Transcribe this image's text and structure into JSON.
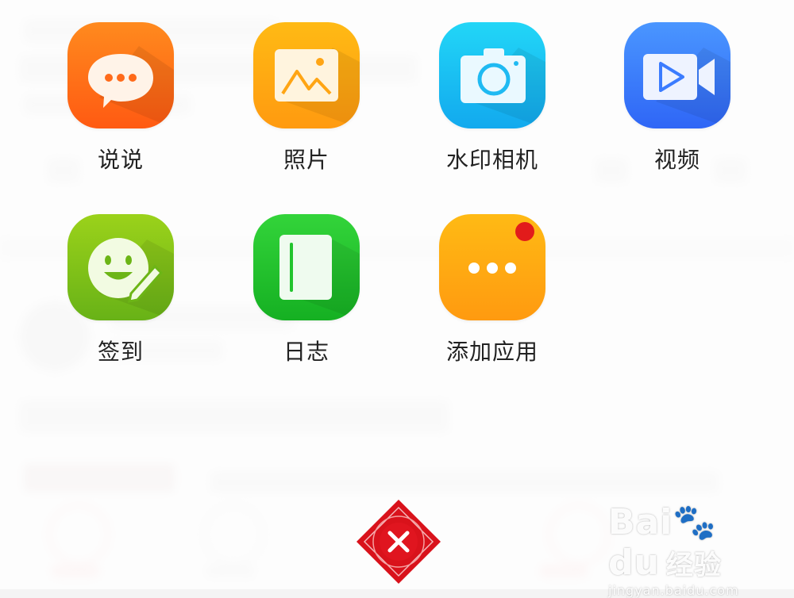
{
  "apps": [
    {
      "id": "shuoshuo",
      "label": "说说",
      "icon": "speech-bubble-icon",
      "color": "#ff6a1a"
    },
    {
      "id": "photo",
      "label": "照片",
      "icon": "photo-icon",
      "color": "#ffa514"
    },
    {
      "id": "watermark_camera",
      "label": "水印相机",
      "icon": "camera-icon",
      "color": "#1fbaf2"
    },
    {
      "id": "video",
      "label": "视频",
      "icon": "video-icon",
      "color": "#3b7cff"
    },
    {
      "id": "checkin",
      "label": "签到",
      "icon": "smiley-pen-icon",
      "color": "#7fc21a"
    },
    {
      "id": "diary",
      "label": "日志",
      "icon": "notebook-icon",
      "color": "#22c42e"
    },
    {
      "id": "add_app",
      "label": "添加应用",
      "icon": "more-dots-icon",
      "color": "#ffa514",
      "badge": true
    }
  ],
  "watermark": {
    "brand": "Bai",
    "brand2": "du",
    "cn": "经验",
    "url": "jingyan.baidu.com"
  },
  "colors": {
    "close": "#d9121b"
  }
}
